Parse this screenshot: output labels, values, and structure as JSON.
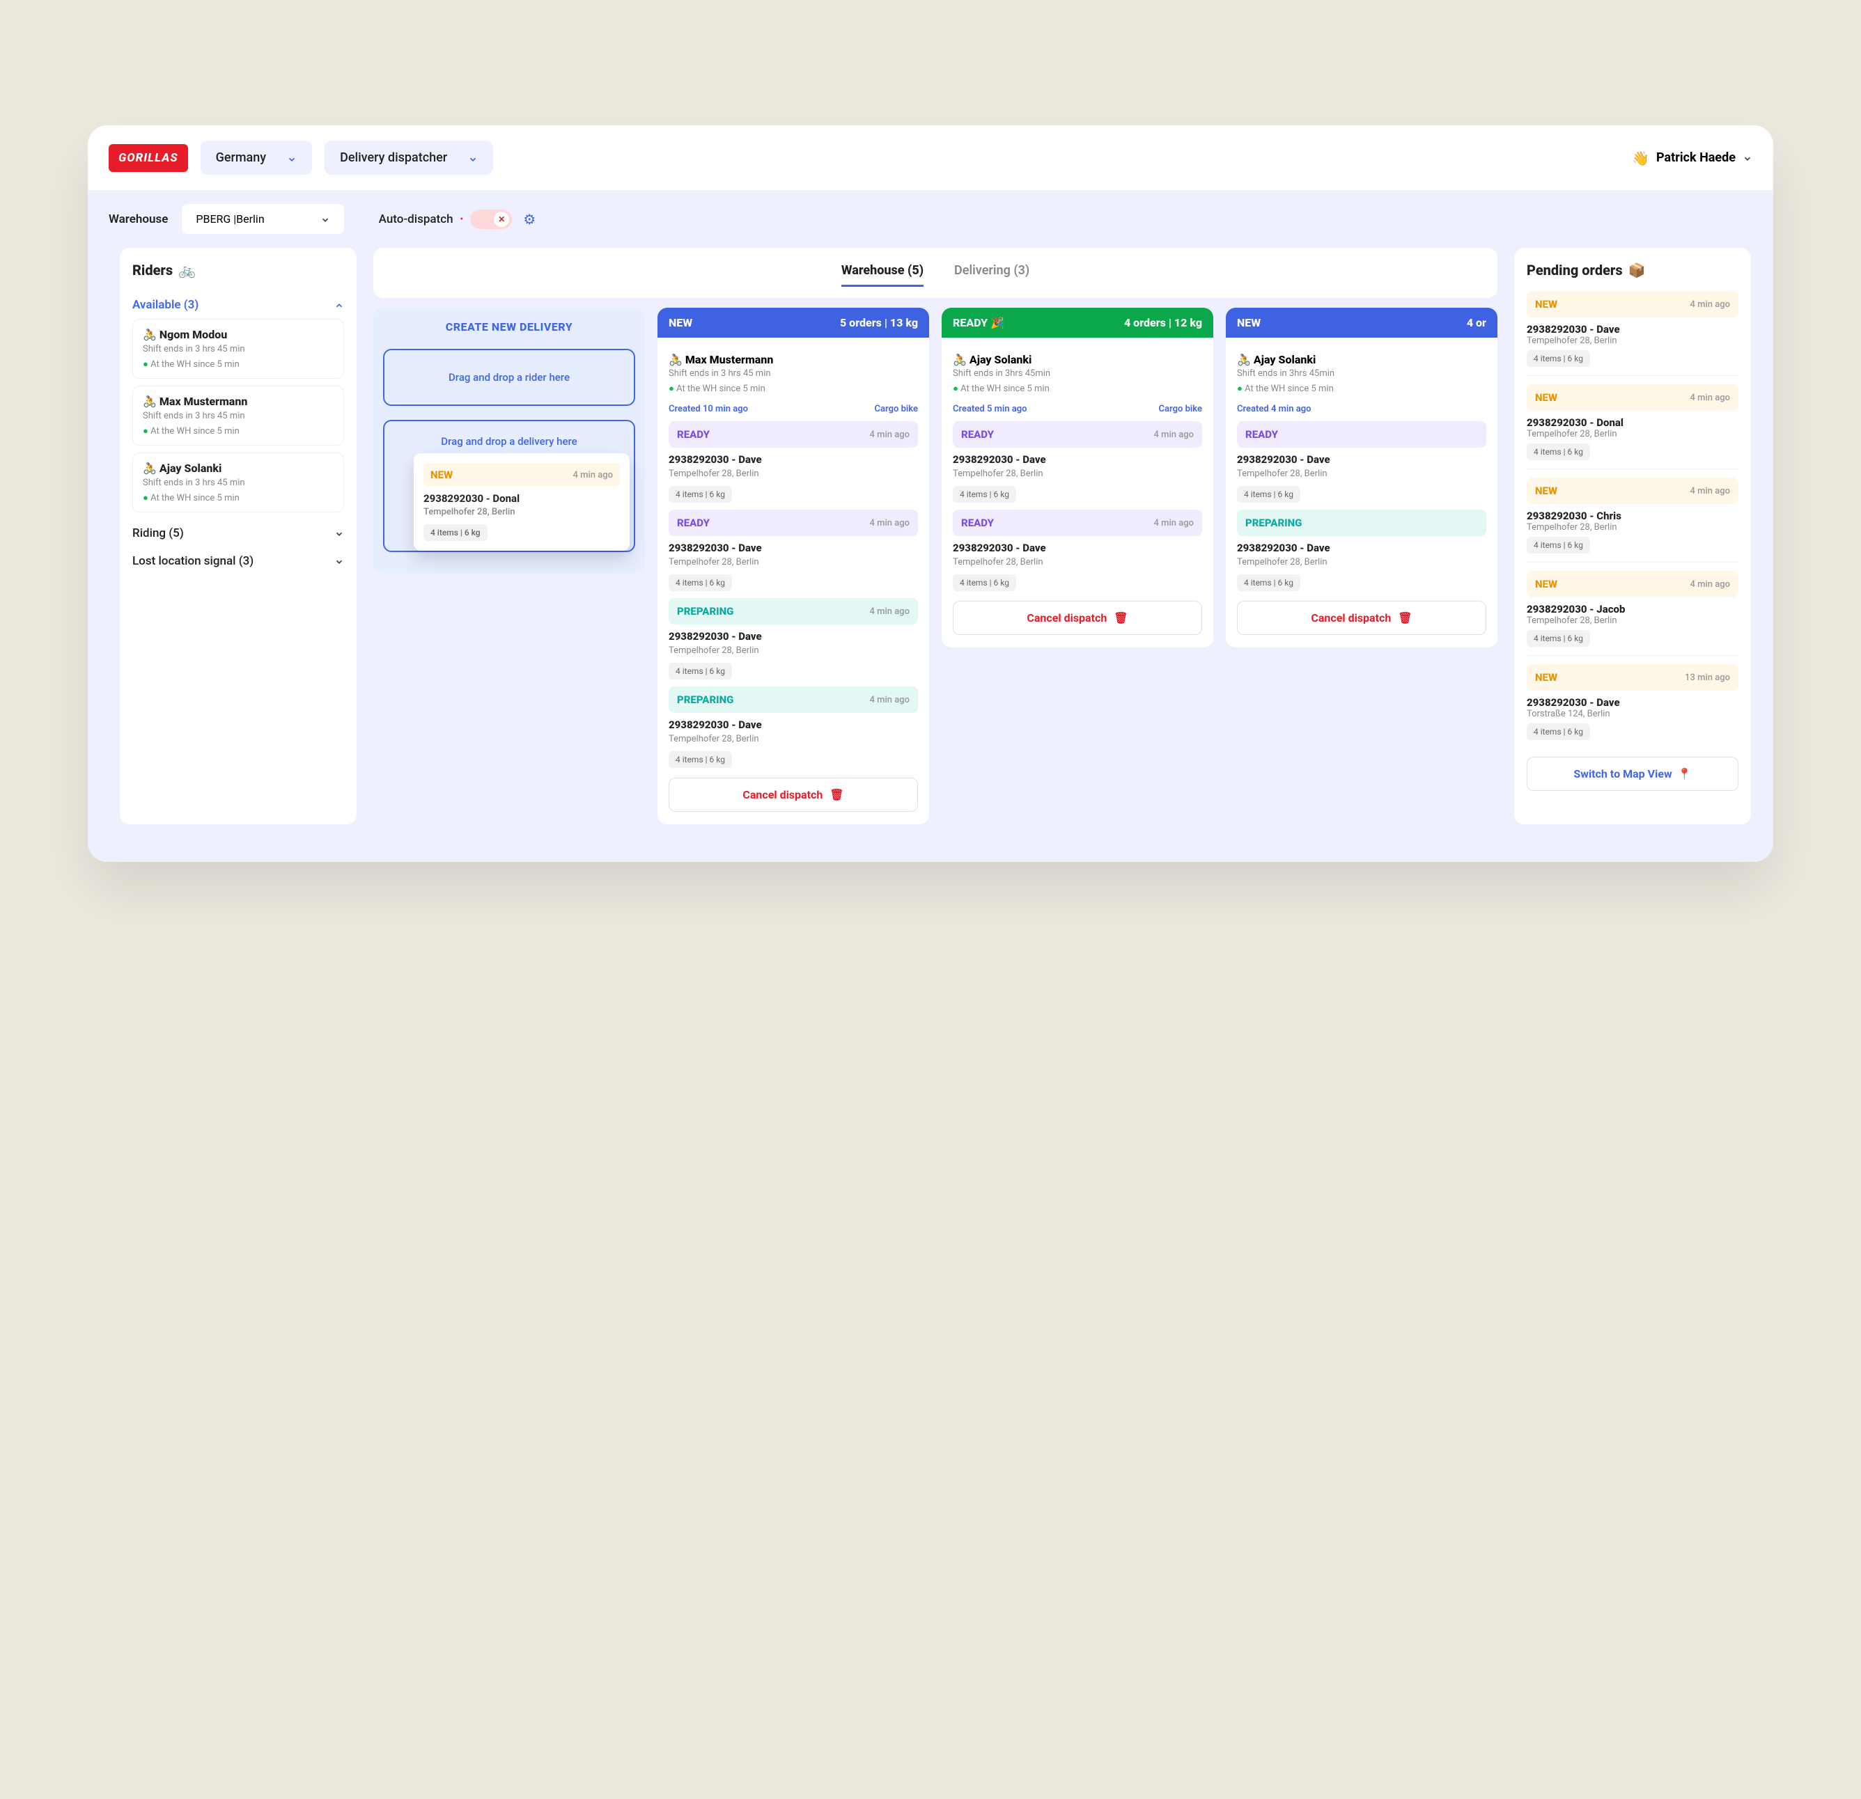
{
  "header": {
    "logo": "GORILLAS",
    "country_selector": "Germany",
    "view_selector": "Delivery dispatcher",
    "user_name": "Patrick Haede",
    "user_emoji": "👋"
  },
  "subheader": {
    "warehouse_label": "Warehouse",
    "warehouse_value": "PBERG |Berlin",
    "auto_dispatch_label": "Auto-dispatch"
  },
  "riders_panel": {
    "title": "Riders",
    "icon": "🚲",
    "available_label": "Available (3)",
    "riding_label": "Riding (5)",
    "lost_label": "Lost location signal (3)",
    "available": [
      {
        "name": "Ngom Modou",
        "icon": "🚴",
        "shift": "Shift ends in 3 hrs 45 min",
        "status": "At the WH since 5 min"
      },
      {
        "name": "Max Mustermann",
        "icon": "🚴",
        "shift": "Shift ends in 3 hrs 45 min",
        "status": "At the WH since 5 min"
      },
      {
        "name": "Ajay Solanki",
        "icon": "🚴",
        "shift": "Shift ends in 3 hrs 45 min",
        "status": "At the WH since 5 min"
      }
    ]
  },
  "tabs": {
    "warehouse": "Warehouse (5)",
    "delivering": "Delivering (3)"
  },
  "create": {
    "title": "CREATE NEW DELIVERY",
    "drop_rider": "Drag and drop a rider here",
    "drop_delivery": "Drag and drop a delivery here",
    "hover_card": {
      "status": "NEW",
      "time": "4 min ago",
      "title": "2938292030 - Donal",
      "addr": "Tempelhofer 28, Berlin",
      "items": "4 items | 6 kg"
    }
  },
  "dispatch_cols": [
    {
      "head_type": "new",
      "head_label": "NEW",
      "head_meta": "5 orders | 13 kg",
      "rider": {
        "name": "Max Mustermann",
        "icon": "🚴",
        "shift": "Shift ends in 3 hrs 45 min",
        "status": "At the WH since 5 min"
      },
      "meta": {
        "created": "Created 10 min ago",
        "vehicle": "Cargo bike"
      },
      "orders": [
        {
          "status": "READY",
          "status_type": "ready",
          "time": "4 min ago",
          "title": "2938292030 - Dave",
          "addr": "Tempelhofer 28, Berlin",
          "items": "4 items | 6 kg"
        },
        {
          "status": "READY",
          "status_type": "ready",
          "time": "4 min ago",
          "title": "2938292030 - Dave",
          "addr": "Tempelhofer 28, Berlin",
          "items": "4 items | 6 kg"
        },
        {
          "status": "PREPARING",
          "status_type": "preparing",
          "time": "4 min ago",
          "title": "2938292030 - Dave",
          "addr": "Tempelhofer 28, Berlin",
          "items": "4 items | 6 kg"
        },
        {
          "status": "PREPARING",
          "status_type": "preparing",
          "time": "4 min ago",
          "title": "2938292030 - Dave",
          "addr": "Tempelhofer 28, Berlin",
          "items": "4 items | 6 kg"
        }
      ],
      "cancel": "Cancel dispatch"
    },
    {
      "head_type": "ready",
      "head_label": "READY 🎉",
      "head_meta": "4 orders | 12 kg",
      "rider": {
        "name": "Ajay Solanki",
        "icon": "🚴",
        "shift": "Shift ends in 3hrs 45min",
        "status": "At the WH since 5 min"
      },
      "meta": {
        "created": "Created 5 min ago",
        "vehicle": "Cargo bike"
      },
      "orders": [
        {
          "status": "READY",
          "status_type": "ready",
          "time": "4 min ago",
          "title": "2938292030 - Dave",
          "addr": "Tempelhofer 28, Berlin",
          "items": "4 items | 6 kg"
        },
        {
          "status": "READY",
          "status_type": "ready",
          "time": "4 min ago",
          "title": "2938292030 - Dave",
          "addr": "Tempelhofer 28, Berlin",
          "items": "4 items | 6 kg"
        }
      ],
      "cancel": "Cancel dispatch"
    },
    {
      "head_type": "new",
      "head_label": "NEW",
      "head_meta": "4 or",
      "rider": {
        "name": "Ajay Solanki",
        "icon": "🚴",
        "shift": "Shift ends in 3hrs 45min",
        "status": "At the WH since 5 min"
      },
      "meta": {
        "created": "Created 4 min ago",
        "vehicle": ""
      },
      "orders": [
        {
          "status": "READY",
          "status_type": "ready",
          "time": "",
          "title": "2938292030 - Dave",
          "addr": "Tempelhofer 28, Berlin",
          "items": "4 items | 6 kg"
        },
        {
          "status": "PREPARING",
          "status_type": "preparing",
          "time": "",
          "title": "2938292030 - Dave",
          "addr": "Tempelhofer 28, Berlin",
          "items": "4 items | 6 kg"
        }
      ],
      "cancel": "Cancel dispatch"
    }
  ],
  "pending": {
    "title": "Pending orders",
    "icon": "📦",
    "orders": [
      {
        "status": "NEW",
        "time": "4 min ago",
        "title": "2938292030 - Dave",
        "addr": "Tempelhofer 28, Berlin",
        "items": "4 items | 6 kg"
      },
      {
        "status": "NEW",
        "time": "4 min ago",
        "title": "2938292030 - Donal",
        "addr": "Tempelhofer 28, Berlin",
        "items": "4 items | 6 kg"
      },
      {
        "status": "NEW",
        "time": "4 min ago",
        "title": "2938292030 - Chris",
        "addr": "Tempelhofer 28, Berlin",
        "items": "4 items | 6 kg"
      },
      {
        "status": "NEW",
        "time": "4 min ago",
        "title": "2938292030 - Jacob",
        "addr": "Tempelhofer 28, Berlin",
        "items": "4 items | 6 kg"
      },
      {
        "status": "NEW",
        "time": "13 min ago",
        "title": "2938292030 - Dave",
        "addr": "Torstraße 124, Berlin",
        "items": "4 items | 6 kg"
      }
    ],
    "map_button": "Switch to Map View"
  }
}
